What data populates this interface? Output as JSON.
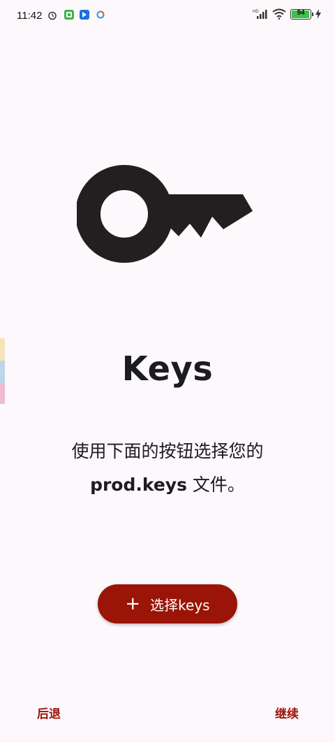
{
  "status_bar": {
    "time": "11:42",
    "battery": "94",
    "network": "HD"
  },
  "main": {
    "title": "Keys",
    "description_line1": "使用下面的按钮选择您的",
    "description_bold": "prod.keys",
    "description_rest": " 文件。",
    "select_button_icon": "+",
    "select_button_label": "选择keys"
  },
  "footer": {
    "back_label": "后退",
    "next_label": "继续"
  },
  "icons": {
    "key": "key-icon"
  },
  "colors": {
    "accent": "#9a1407",
    "background": "#fcf8fb",
    "text": "#1c1b1f"
  }
}
